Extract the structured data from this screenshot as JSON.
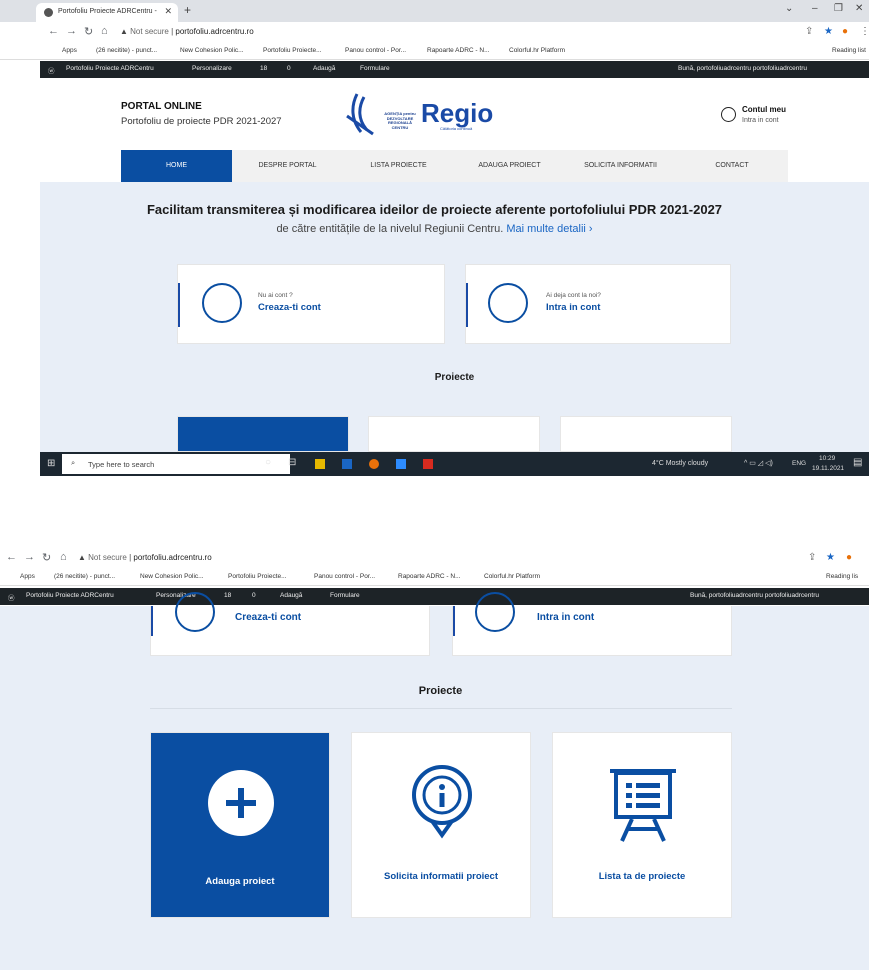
{
  "browser": {
    "tab_title": "Portofoliu Proiecte ADRCentru - ",
    "not_secure": "Not secure",
    "url": "portofoliu.adrcentru.ro",
    "reading_list": "Reading list",
    "reading_list_short": "Reading lis",
    "bookmarks": [
      "Apps",
      "(26 necitite) - punct...",
      "New Cohesion Polic...",
      "Portofoliu Proiecte...",
      "Panou control - Por...",
      "Rapoarte ADRC - N...",
      "Colorful.hr Platform"
    ],
    "profile_initial": "!"
  },
  "wp_admin": {
    "site": "Portofoliu Proiecte ADRCentru",
    "customize": "Personalizare",
    "updates": "18",
    "comments": "0",
    "add_new": "Adaugă",
    "forms": "Formulare",
    "greeting": "Bună, portofoliuadrcentru portofoliuadrcentru"
  },
  "header": {
    "title": "PORTAL ONLINE",
    "subtitle": "Portofoliu de proiecte PDR 2021-2027",
    "agency_logo_text": "AGENȚIA pentru DEZVOLTARE REGIONALĂ CENTRU",
    "regio_logo": "Regio",
    "regio_tagline": "Călătoria continuă",
    "account_title": "Contul meu",
    "account_sub": "Intra in cont"
  },
  "menu": [
    "HOME",
    "DESPRE PORTAL",
    "LISTA PROIECTE",
    "ADAUGA PROIECT",
    "SOLICITA INFORMATII",
    "CONTACT"
  ],
  "hero": {
    "title": "Facilitam transmiterea și modificarea ideilor de proiecte aferente portofoliului PDR 2021-2027",
    "subtitle": "de către entitățile de la nivelul Regiunii Centru.",
    "link": "Mai multe detalii ›"
  },
  "account_cards": [
    {
      "small": "Nu ai cont ?",
      "big": "Creaza-ti cont"
    },
    {
      "small": "Ai deja cont la noi?",
      "big": "Intra in cont"
    }
  ],
  "projects": {
    "section_title": "Proiecte",
    "tiles": [
      "Adauga proiect",
      "Solicita informatii proiect",
      "Lista ta de proiecte"
    ]
  },
  "taskbar": {
    "search_placeholder": "Type here to search",
    "weather": "4°C  Mostly cloudy",
    "lang": "ENG",
    "time": "10:29",
    "date": "19.11.2021"
  },
  "colors": {
    "brand_blue": "#0a4ea2",
    "page_bg": "#e8eef7",
    "wp_bar": "#1d2327"
  }
}
